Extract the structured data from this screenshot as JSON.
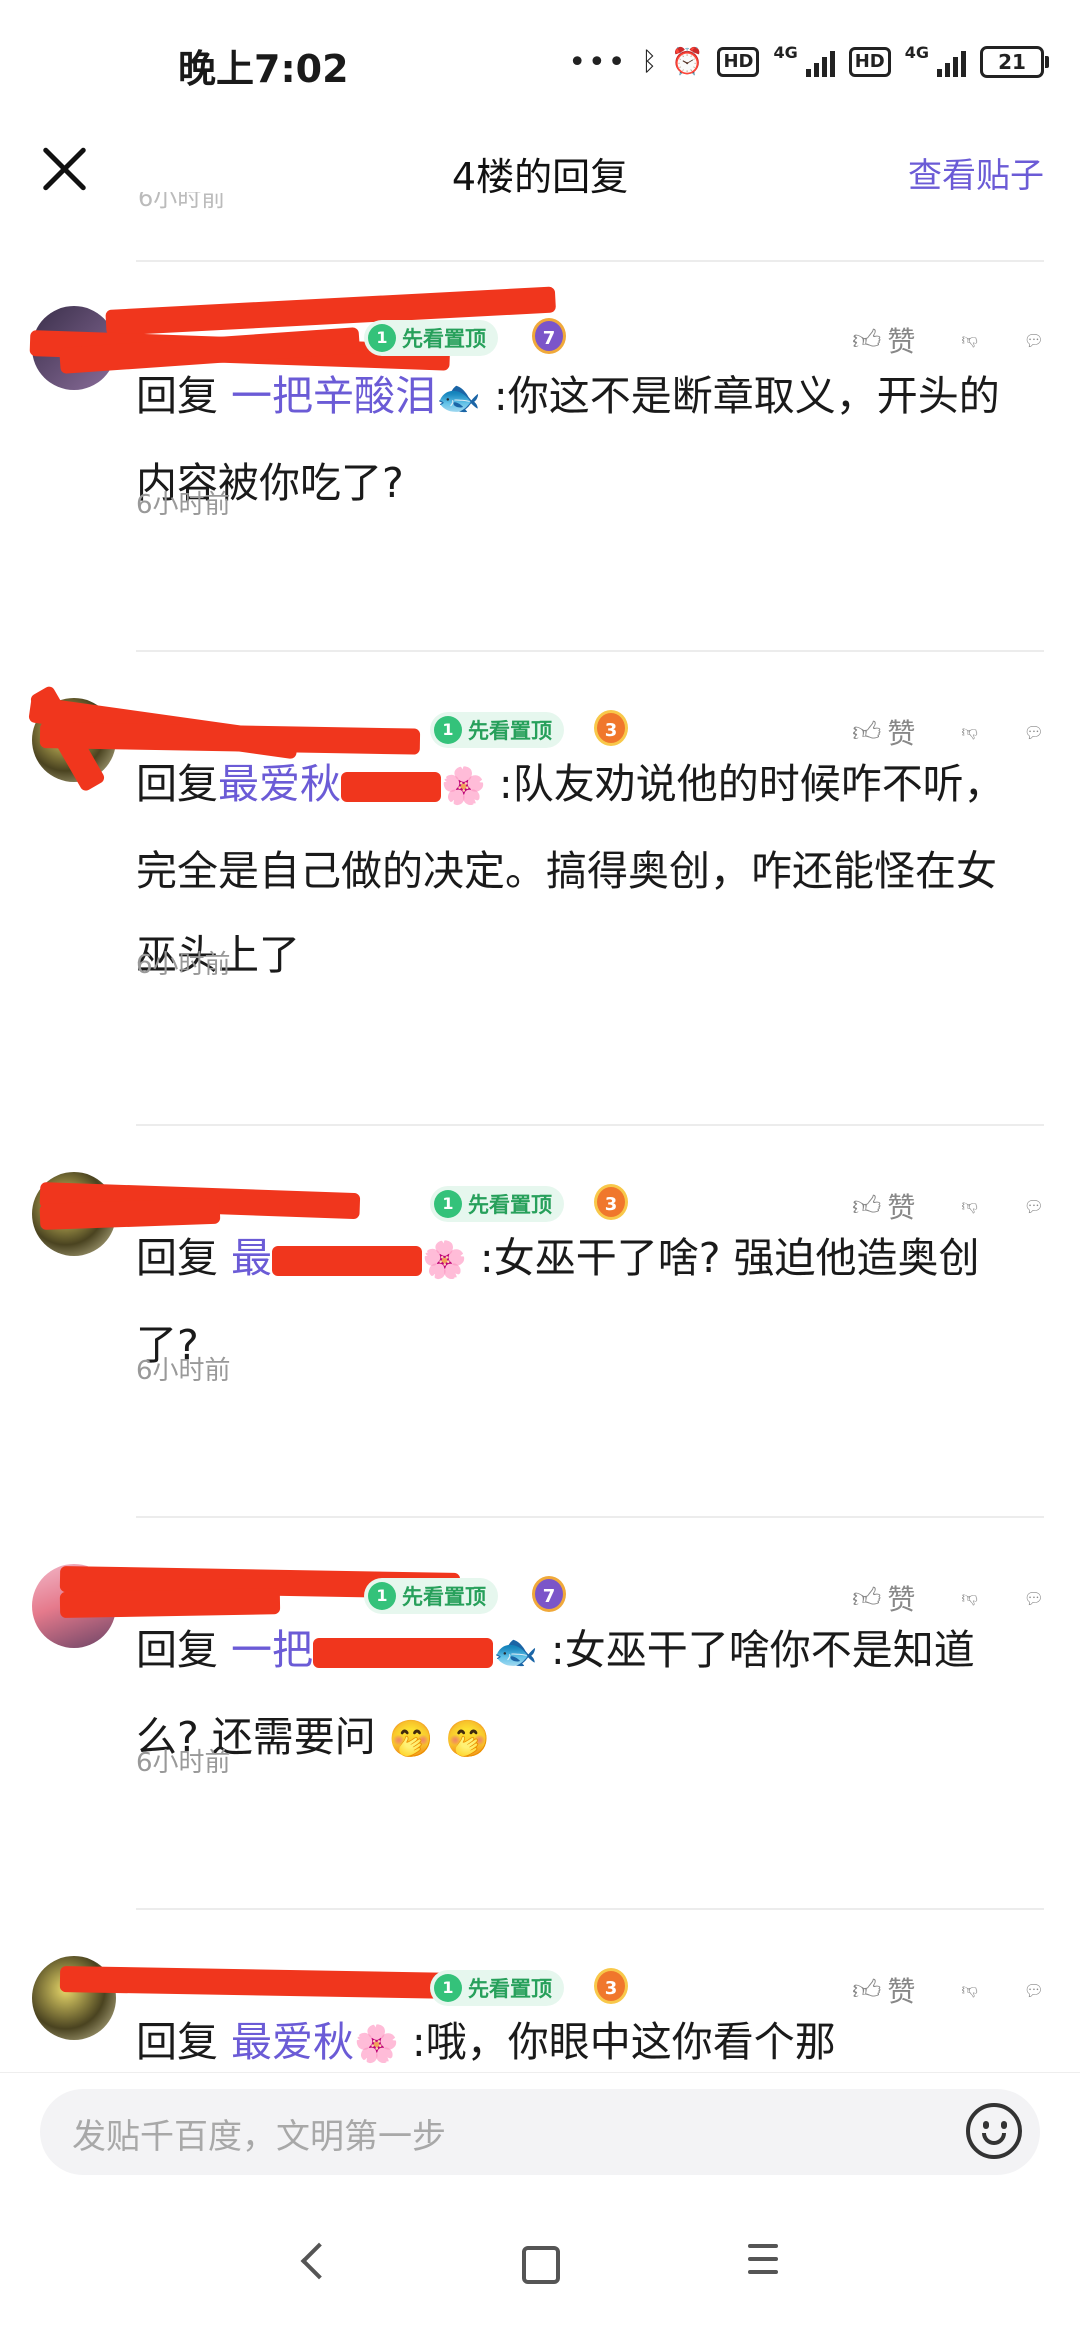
{
  "status_bar": {
    "time": "晚上7:02",
    "battery": "21",
    "hd": "HD",
    "network": "4G"
  },
  "header": {
    "title": "4楼的回复",
    "view_post": "查看贴子"
  },
  "like_label": "赞",
  "reply_prefix": "回复",
  "comments": [
    {
      "badge": "先看置顶",
      "badge_num": "1",
      "level": "7",
      "target": "一把辛酸泪",
      "target_emoji": "🐟",
      "text": ":你这不是断章取义，开头的内容被你吃了?",
      "time": "6小时前"
    },
    {
      "badge": "先看置顶",
      "badge_num": "1",
      "level": "3",
      "target": "最爱秋",
      "target_emoji": "🌸",
      "text": ":队友劝说他的时候咋不听，完全是自己做的决定。搞得奥创，咋还能怪在女巫头上了",
      "time": "6小时前"
    },
    {
      "badge": "先看置顶",
      "badge_num": "1",
      "level": "3",
      "target": "最",
      "target_emoji": "🌸",
      "text": ":女巫干了啥? 强迫他造奥创了?",
      "time": "6小时前"
    },
    {
      "badge": "先看置顶",
      "badge_num": "1",
      "level": "7",
      "target": "一把",
      "target_emoji": "🐟",
      "text": ":女巫干了啥你不是知道么? 还需要问",
      "emoji_tail": "🤭 🤭",
      "time": "6小时前"
    },
    {
      "badge": "先看置顶",
      "badge_num": "1",
      "level": "3",
      "target": "最爱秋",
      "target_emoji": "🌸",
      "text": ":哦，你眼中这你看个那",
      "time": ""
    }
  ],
  "input": {
    "placeholder": "发贴千百度，文明第一步"
  }
}
